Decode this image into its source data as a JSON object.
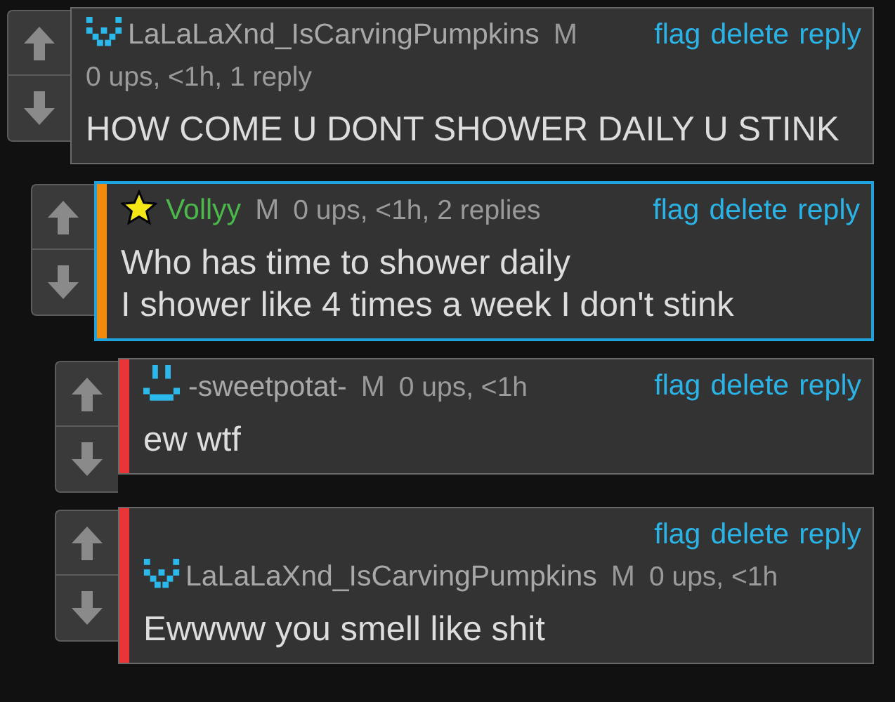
{
  "comments": [
    {
      "avatar": {
        "kind": "pixel-w"
      },
      "username": {
        "text": "LaLaLaXnd_IsCarvingPumpkins",
        "color": "#a8a8a8"
      },
      "badge": "M",
      "meta": "0 ups, <1h, 1 reply",
      "actions": [
        "flag",
        "delete",
        "reply"
      ],
      "text": "HOW COME U DONT SHOWER DAILY U STINK",
      "highlighted": false,
      "children": [
        {
          "avatar": {
            "kind": "star"
          },
          "username": {
            "text": "Vollyy",
            "color": "#4cb84c"
          },
          "badge": "M",
          "meta": "0 ups, <1h, 2 replies",
          "actions": [
            "flag",
            "delete",
            "reply"
          ],
          "text": "Who has time to shower daily\nI shower like 4 times a week I don't stink",
          "highlighted": true,
          "color": "#f28a0c",
          "children": [
            {
              "avatar": {
                "kind": "pixel-smile"
              },
              "username": {
                "text": "-sweetpotat-",
                "color": "#a8a8a8"
              },
              "badge": "M",
              "meta": "0 ups, <1h",
              "actions": [
                "flag",
                "delete",
                "reply"
              ],
              "text": "ew wtf",
              "highlighted": false,
              "color": "#e83535"
            },
            {
              "avatar": {
                "kind": "pixel-w"
              },
              "username": {
                "text": "LaLaLaXnd_IsCarvingPumpkins",
                "color": "#a8a8a8"
              },
              "badge": "M",
              "meta": "0 ups, <1h",
              "actions": [
                "flag",
                "delete",
                "reply"
              ],
              "text": "Ewwww you smell like shit",
              "highlighted": false,
              "color": "#e83535"
            }
          ]
        }
      ]
    }
  ]
}
